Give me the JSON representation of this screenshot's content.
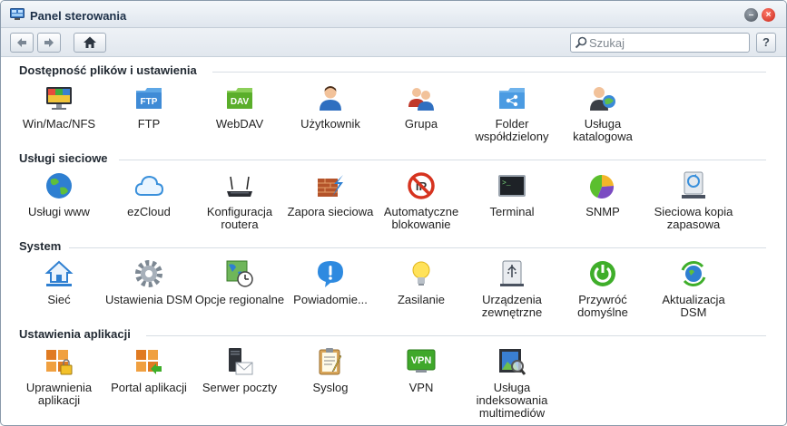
{
  "window": {
    "title": "Panel sterowania"
  },
  "toolbar": {
    "search_placeholder": "Szukaj",
    "help_label": "?"
  },
  "sections": [
    {
      "title": "Dostępność plików i ustawienia",
      "items": [
        {
          "label": "Win/Mac/NFS",
          "icon": "monitor-icon"
        },
        {
          "label": "FTP",
          "icon": "ftp-folder-icon"
        },
        {
          "label": "WebDAV",
          "icon": "dav-folder-icon"
        },
        {
          "label": "Użytkownik",
          "icon": "user-icon"
        },
        {
          "label": "Grupa",
          "icon": "group-icon"
        },
        {
          "label": "Folder współdzielony",
          "icon": "shared-folder-icon"
        },
        {
          "label": "Usługa katalogowa",
          "icon": "directory-service-icon"
        }
      ]
    },
    {
      "title": "Usługi sieciowe",
      "items": [
        {
          "label": "Usługi www",
          "icon": "globe-icon"
        },
        {
          "label": "ezCloud",
          "icon": "cloud-icon"
        },
        {
          "label": "Konfiguracja routera",
          "icon": "router-icon"
        },
        {
          "label": "Zapora sieciowa",
          "icon": "firewall-icon"
        },
        {
          "label": "Automatyczne blokowanie",
          "icon": "block-icon"
        },
        {
          "label": "Terminal",
          "icon": "terminal-icon"
        },
        {
          "label": "SNMP",
          "icon": "pie-chart-icon"
        },
        {
          "label": "Sieciowa kopia zapasowa",
          "icon": "network-backup-icon"
        }
      ]
    },
    {
      "title": "System",
      "items": [
        {
          "label": "Sieć",
          "icon": "network-home-icon"
        },
        {
          "label": "Ustawienia DSM",
          "icon": "gear-icon"
        },
        {
          "label": "Opcje regionalne",
          "icon": "map-clock-icon"
        },
        {
          "label": "Powiadomie...",
          "icon": "info-bubble-icon"
        },
        {
          "label": "Zasilanie",
          "icon": "lightbulb-icon"
        },
        {
          "label": "Urządzenia zewnętrzne",
          "icon": "usb-drive-icon"
        },
        {
          "label": "Przywróć domyślne",
          "icon": "power-reset-icon"
        },
        {
          "label": "Aktualizacja DSM",
          "icon": "update-globe-icon"
        }
      ]
    },
    {
      "title": "Ustawienia aplikacji",
      "items": [
        {
          "label": "Uprawnienia aplikacji",
          "icon": "app-privileges-icon"
        },
        {
          "label": "Portal aplikacji",
          "icon": "app-portal-icon"
        },
        {
          "label": "Serwer poczty",
          "icon": "mail-server-icon"
        },
        {
          "label": "Syslog",
          "icon": "clipboard-icon"
        },
        {
          "label": "VPN",
          "icon": "vpn-icon"
        },
        {
          "label": "Usługa indeksowania multimediów",
          "icon": "media-index-icon"
        }
      ]
    }
  ]
}
